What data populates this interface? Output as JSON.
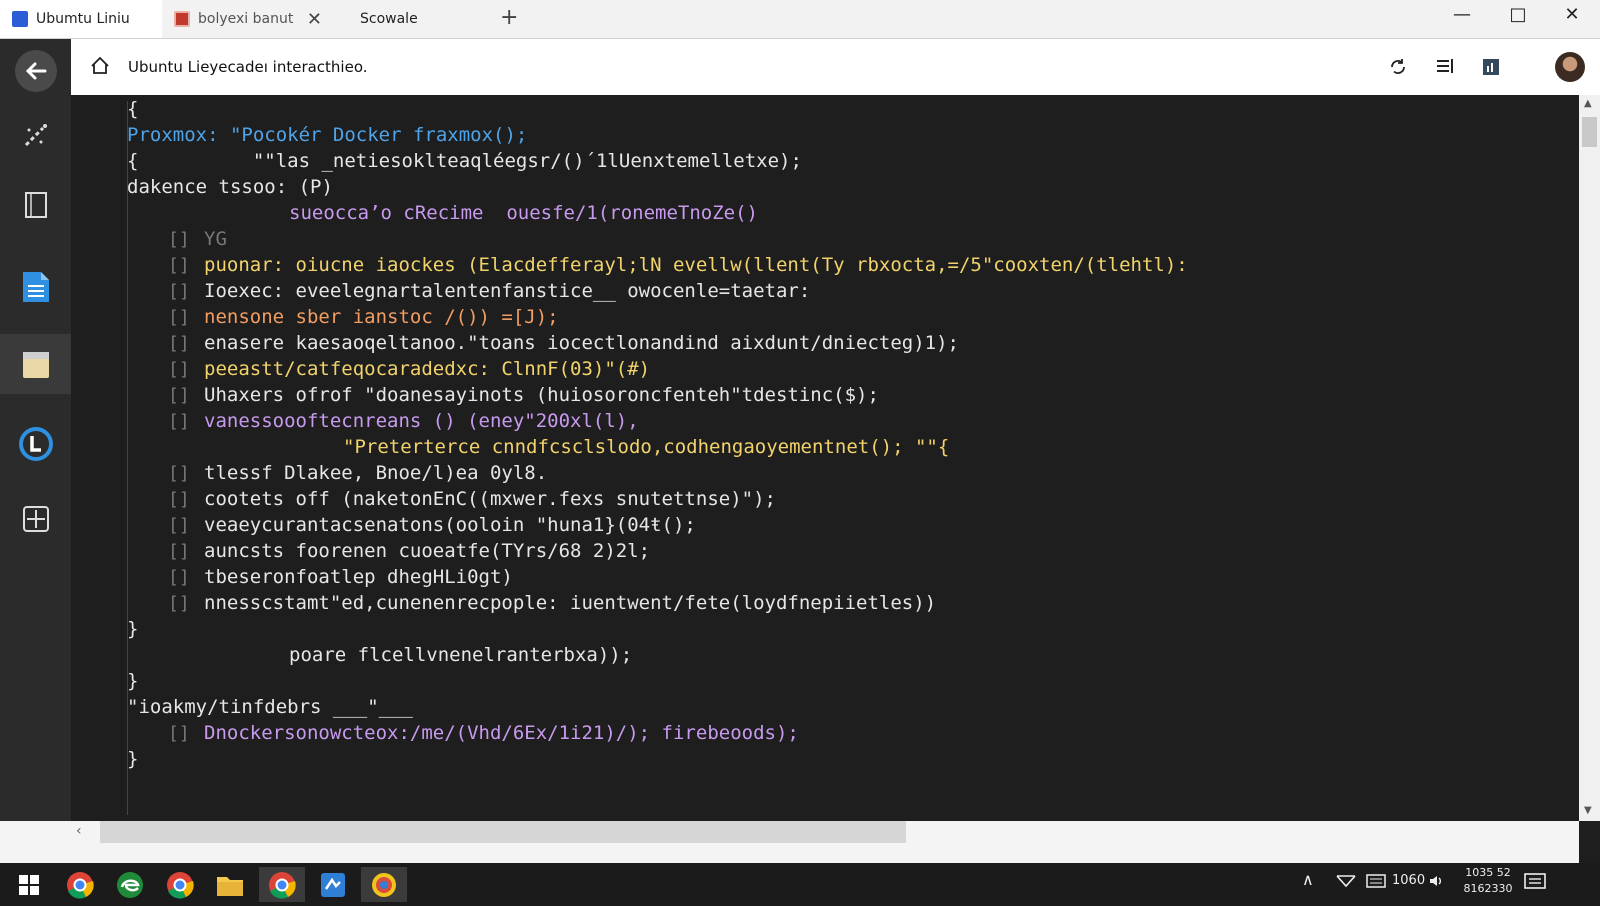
{
  "window": {
    "tabs": [
      {
        "label": "Ubumtu Liniu",
        "active": true
      },
      {
        "label": "bolyexi banut",
        "active": false
      },
      {
        "label": "Scowale",
        "active": false
      }
    ],
    "new_tab_glyph": "+",
    "controls": {
      "minimize": "—",
      "maximize": "□",
      "close": "✕"
    }
  },
  "address_bar": {
    "text": "Ubuntu Lieyecadeı interacthieo.",
    "icons": [
      "home-icon",
      "sync-icon",
      "reader-icon",
      "extension-icon",
      "avatar"
    ]
  },
  "sidebar": {
    "items": [
      "back-icon",
      "magic-wand-icon",
      "tablet-icon",
      "document-icon",
      "clipboard-icon",
      "logo-l-icon",
      "layout-icon"
    ],
    "selected_index": 4
  },
  "code": {
    "lines": [
      {
        "text": "{",
        "color": "#e6e6e6",
        "indent": 0
      },
      {
        "text": "Proxmox: \"Pocokér Docker fraxmox();",
        "color": "#4fa3e8",
        "indent": 0
      },
      {
        "text": "{          \"\"las _netiesoklteaqléegsr/()´1lUenxtemelletxe);",
        "color": "#e6e6e6",
        "indent": 0
      },
      {
        "text": "dakence tssoo: (P)",
        "color": "#e6e6e6",
        "indent": 0
      },
      {
        "text": "sueocca’o cRecime  ouesfe/1(ronemeTnoZe()",
        "color": "#c89aef",
        "indent": 2
      },
      {
        "text": "YG",
        "color": "#777777",
        "indent": 1
      },
      {
        "text": "puonar: oiucne iaockes (Elacdefferayl;lN evellw(llent(Ty rbxocta,=/5\"cooxten/(tlehtl):",
        "color": "#f2d36b",
        "indent": 1
      },
      {
        "text": "Ioexec: eveelegnartalentenfanstice__ owocenle=taetar:",
        "color": "#e6e6e6",
        "indent": 1
      },
      {
        "text": "nensone sber ianstoc /()) =[J);",
        "color": "#f29d62",
        "indent": 1
      },
      {
        "text": "enasere kaesaoqeltanoo.\"toans iocectlonandind aixdunt/dniecteg)1);",
        "color": "#e6e6e6",
        "indent": 1
      },
      {
        "text": "peeastt/catfeqocaradedxc: ClnnF(03)\"(#)",
        "color": "#f2d36b",
        "indent": 1
      },
      {
        "text": "Uhaxers ofrof \"doanesayinots (huiosoroncfenteh\"tdestinc($);",
        "color": "#e6e6e6",
        "indent": 1
      },
      {
        "text": "vanessoooftecnreans () (eney\"200xl(l),",
        "color": "#c89aef",
        "indent": 1
      },
      {
        "text": "\"Preterterce cnndfcsclslodo,codhengaoyementnet(); \"\"{",
        "color": "#f2d36b",
        "indent": 3
      },
      {
        "text": "tlessf Dlakee, Bnoe/l)ea 0yl8.",
        "color": "#e6e6e6",
        "indent": 1
      },
      {
        "text": "cootets off (naketonEnC((mxwer.fexs snutettnse)\");",
        "color": "#e6e6e6",
        "indent": 1
      },
      {
        "text": "veaeycurantacsenatons(ooloin \"huna1}(04ŧ();",
        "color": "#e6e6e6",
        "indent": 1
      },
      {
        "text": "auncsts foorenen cuoeatfe(TYrs/68 2)2l;",
        "color": "#e6e6e6",
        "indent": 1
      },
      {
        "text": "tbeseronfoatlep dhegHLi0gt)",
        "color": "#e6e6e6",
        "indent": 1
      },
      {
        "text": "nnesscstamt\"ed,cunenenrecpople: iuentwent/fete(loydfnepiietles))",
        "color": "#e6e6e6",
        "indent": 1
      },
      {
        "text": "}",
        "color": "#e6e6e6",
        "indent": 0
      },
      {
        "text": "poare flcellvnenelranterbxa));",
        "color": "#e6e6e6",
        "indent": 2
      },
      {
        "text": "}",
        "color": "#e6e6e6",
        "indent": 0
      },
      {
        "text": "\"ioakmy/tinfdebrs ___\"___",
        "color": "#e6e6e6",
        "indent": 0
      },
      {
        "text": "Dnockersonowcteox:/me/(Vhd/6Ex/1i21)/); firebeoods);",
        "color": "#c89aef",
        "indent": 1
      },
      {
        "text": "}",
        "color": "#e6e6e6",
        "indent": 0
      }
    ]
  },
  "taskbar": {
    "apps": [
      "windows-start-icon",
      "chrome-icon",
      "edge-icon",
      "chrome-icon",
      "folder-icon",
      "chrome-icon",
      "vscode-icon",
      "app-icon"
    ],
    "tray": {
      "chevron": "∧",
      "speed": "1060",
      "time": "1035 52",
      "date": "8162330"
    }
  }
}
